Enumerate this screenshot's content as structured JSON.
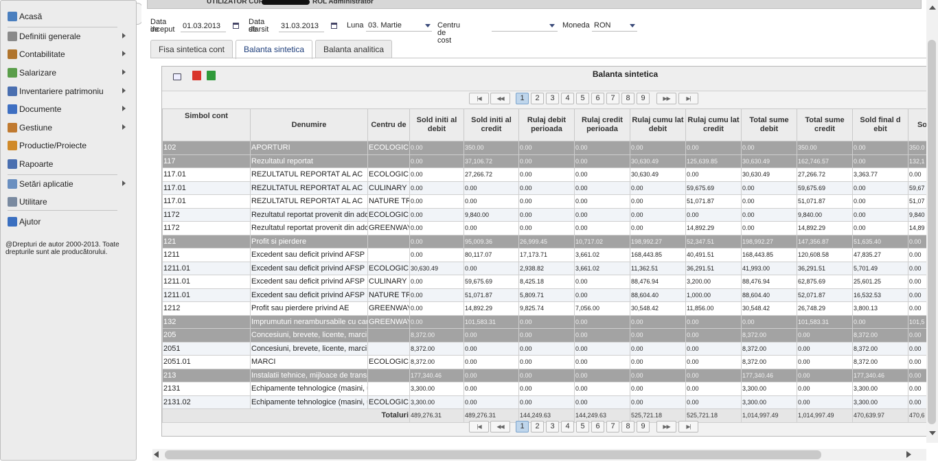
{
  "sidebar": {
    "items": [
      {
        "label": "Acasă",
        "icon": "home-icon",
        "color": "#4a7fbf",
        "arrow": false
      },
      {
        "label": "Definitii generale",
        "icon": "gears-icon",
        "color": "#8a8a8a",
        "arrow": true
      },
      {
        "label": "Contabilitate",
        "icon": "ledger-icon",
        "color": "#b0742c",
        "arrow": true
      },
      {
        "label": "Salarizare",
        "icon": "payroll-icon",
        "color": "#5a9e4a",
        "arrow": true
      },
      {
        "label": "Inventariere patrimoniu",
        "icon": "inventory-icon",
        "color": "#4a6fb0",
        "arrow": true
      },
      {
        "label": "Documente",
        "icon": "documents-icon",
        "color": "#3e6fc2",
        "arrow": true
      },
      {
        "label": "Gestiune",
        "icon": "management-icon",
        "color": "#c07a30",
        "arrow": true
      },
      {
        "label": "Productie/Proiecte",
        "icon": "truck-icon",
        "color": "#d08a2a",
        "arrow": false
      },
      {
        "label": "Rapoarte",
        "icon": "reports-icon",
        "color": "#4a6fb0",
        "arrow": false
      },
      {
        "label": "Setări aplicatie",
        "icon": "settings-icon",
        "color": "#6a8fc0",
        "arrow": true
      },
      {
        "label": "Utilitare",
        "icon": "tools-icon",
        "color": "#7a8aa0",
        "arrow": false
      },
      {
        "label": "Ajutor",
        "icon": "help-icon",
        "color": "#3a6fc0",
        "arrow": false
      }
    ],
    "copyright": "@Drepturi de autor 2000-2013. Toate drepturile sunt ale producătorului."
  },
  "userbar": {
    "left": "UTILIZATOR CURENT",
    "right": "ROL Administrator"
  },
  "filters": {
    "start_label1": "Data de",
    "start_label2": "inceput",
    "start_value": "01.03.2013",
    "end_label1": "Data de",
    "end_label2": "sfarsit",
    "end_value": "31.03.2013",
    "month_label": "Luna",
    "month_value": "03. Martie",
    "cost_center_label": "Centru de cost",
    "cost_center_value": "",
    "currency_label": "Moneda",
    "currency_value": "RON"
  },
  "tabs": [
    "Fisa sintetica cont",
    "Balanta sintetica",
    "Balanta analitica"
  ],
  "panel": {
    "title": "Balanta sintetica"
  },
  "pager": {
    "pages": [
      "1",
      "2",
      "3",
      "4",
      "5",
      "6",
      "7",
      "8",
      "9"
    ],
    "current": "1"
  },
  "columns": [
    "Simbol cont",
    "Denumire",
    "Centru de",
    "Sold initi al debit",
    "Sold initi al credit",
    "Rulaj debit perioada",
    "Rulaj credit perioada",
    "Rulaj cumu lat debit",
    "Rulaj cumu lat credit",
    "Total sume debit",
    "Total sume credit",
    "Sold final d ebit",
    "Sol"
  ],
  "rows": [
    {
      "g": true,
      "c": [
        "102",
        "APORTURI",
        "ECOLOGIC",
        "0.00",
        "350.00",
        "0.00",
        "0.00",
        "0.00",
        "0.00",
        "0.00",
        "350.00",
        "0.00",
        "350.0"
      ]
    },
    {
      "g": true,
      "c": [
        "117",
        "Rezultatul reportat",
        "",
        "0.00",
        "37,106.72",
        "0.00",
        "0.00",
        "30,630.49",
        "125,639.85",
        "30,630.49",
        "162,746.57",
        "0.00",
        "132,1"
      ]
    },
    {
      "g": false,
      "c": [
        "117.01",
        "REZULTATUL REPORTAT AL AC",
        "ECOLOGIC",
        "0.00",
        "27,266.72",
        "0.00",
        "0.00",
        "30,630.49",
        "0.00",
        "30,630.49",
        "27,266.72",
        "3,363.77",
        "0.00"
      ]
    },
    {
      "g": false,
      "c": [
        "117.01",
        "REZULTATUL REPORTAT AL AC",
        "CULINARY",
        "0.00",
        "0.00",
        "0.00",
        "0.00",
        "0.00",
        "59,675.69",
        "0.00",
        "59,675.69",
        "0.00",
        "59,67"
      ]
    },
    {
      "g": false,
      "c": [
        "117.01",
        "REZULTATUL REPORTAT AL AC",
        "NATURE TR",
        "0.00",
        "0.00",
        "0.00",
        "0.00",
        "0.00",
        "51,071.87",
        "0.00",
        "51,071.87",
        "0.00",
        "51,07"
      ]
    },
    {
      "g": false,
      "c": [
        "1172",
        "Rezultatul reportat provenit din ado",
        "ECOLOGIC",
        "0.00",
        "9,840.00",
        "0.00",
        "0.00",
        "0.00",
        "0.00",
        "0.00",
        "9,840.00",
        "0.00",
        "9,840"
      ]
    },
    {
      "g": false,
      "c": [
        "1172",
        "Rezultatul reportat provenit din ado",
        "GREENWAY",
        "0.00",
        "0.00",
        "0.00",
        "0.00",
        "0.00",
        "14,892.29",
        "0.00",
        "14,892.29",
        "0.00",
        "14,89"
      ]
    },
    {
      "g": true,
      "c": [
        "121",
        "Profit si pierdere",
        "",
        "0.00",
        "95,009.36",
        "26,999.45",
        "10,717.02",
        "198,992.27",
        "52,347.51",
        "198,992.27",
        "147,356.87",
        "51,635.40",
        "0.00"
      ]
    },
    {
      "g": false,
      "c": [
        "1211",
        "Excedent sau deficit privind AFSP",
        "",
        "0.00",
        "80,117.07",
        "17,173.71",
        "3,661.02",
        "168,443.85",
        "40,491.51",
        "168,443.85",
        "120,608.58",
        "47,835.27",
        "0.00"
      ]
    },
    {
      "g": false,
      "c": [
        "1211.01",
        "Excedent sau deficit privind AFSP",
        "ECOLOGIC",
        "30,630.49",
        "0.00",
        "2,938.82",
        "3,661.02",
        "11,362.51",
        "36,291.51",
        "41,993.00",
        "36,291.51",
        "5,701.49",
        "0.00"
      ]
    },
    {
      "g": false,
      "c": [
        "1211.01",
        "Excedent sau deficit privind AFSP",
        "CULINARY",
        "0.00",
        "59,675.69",
        "8,425.18",
        "0.00",
        "88,476.94",
        "3,200.00",
        "88,476.94",
        "62,875.69",
        "25,601.25",
        "0.00"
      ]
    },
    {
      "g": false,
      "c": [
        "1211.01",
        "Excedent sau deficit privind AFSP",
        "NATURE TR",
        "0.00",
        "51,071.87",
        "5,809.71",
        "0.00",
        "88,604.40",
        "1,000.00",
        "88,604.40",
        "52,071.87",
        "16,532.53",
        "0.00"
      ]
    },
    {
      "g": false,
      "c": [
        "1212",
        "Profit sau pierdere privind AE",
        "GREENWAY",
        "0.00",
        "14,892.29",
        "9,825.74",
        "7,056.00",
        "30,548.42",
        "11,856.00",
        "30,548.42",
        "26,748.29",
        "3,800.13",
        "0.00"
      ]
    },
    {
      "g": true,
      "c": [
        "132",
        "Imprumuturi nerambursabile cu car",
        "GREENWAY",
        "0.00",
        "101,583.31",
        "0.00",
        "0.00",
        "0.00",
        "0.00",
        "0.00",
        "101,583.31",
        "0.00",
        "101,5"
      ]
    },
    {
      "g": true,
      "c": [
        "205",
        "Concesiuni, brevete, licente, marci",
        "",
        "8,372.00",
        "0.00",
        "0.00",
        "0.00",
        "0.00",
        "0.00",
        "8,372.00",
        "0.00",
        "8,372.00",
        "0.00"
      ]
    },
    {
      "g": false,
      "c": [
        "2051",
        "Concesiuni, brevete, licente, marci",
        "",
        "8,372.00",
        "0.00",
        "0.00",
        "0.00",
        "0.00",
        "0.00",
        "8,372.00",
        "0.00",
        "8,372.00",
        "0.00"
      ]
    },
    {
      "g": false,
      "c": [
        "2051.01",
        "MARCI",
        "ECOLOGIC",
        "8,372.00",
        "0.00",
        "0.00",
        "0.00",
        "0.00",
        "0.00",
        "8,372.00",
        "0.00",
        "8,372.00",
        "0.00"
      ]
    },
    {
      "g": true,
      "c": [
        "213",
        "Instalatii tehnice, mijloace de transp",
        "",
        "177,340.46",
        "0.00",
        "0.00",
        "0.00",
        "0.00",
        "0.00",
        "177,340.46",
        "0.00",
        "177,340.46",
        "0.00"
      ]
    },
    {
      "g": false,
      "c": [
        "2131",
        "Echipamente tehnologice (masini, u",
        "",
        "3,300.00",
        "0.00",
        "0.00",
        "0.00",
        "0.00",
        "0.00",
        "3,300.00",
        "0.00",
        "3,300.00",
        "0.00"
      ]
    },
    {
      "g": false,
      "c": [
        "2131.02",
        "Echipamente tehnologice (masini, u",
        "ECOLOGIC",
        "3,300.00",
        "0.00",
        "0.00",
        "0.00",
        "0.00",
        "0.00",
        "3,300.00",
        "0.00",
        "3,300.00",
        "0.00"
      ]
    }
  ],
  "totals": {
    "label": "Totaluri",
    "values": [
      "489,276.31",
      "489,276.31",
      "144,249.63",
      "144,249.63",
      "525,721.18",
      "525,721.18",
      "1,014,997.49",
      "1,014,997.49",
      "470,639.97",
      "470,6"
    ]
  }
}
